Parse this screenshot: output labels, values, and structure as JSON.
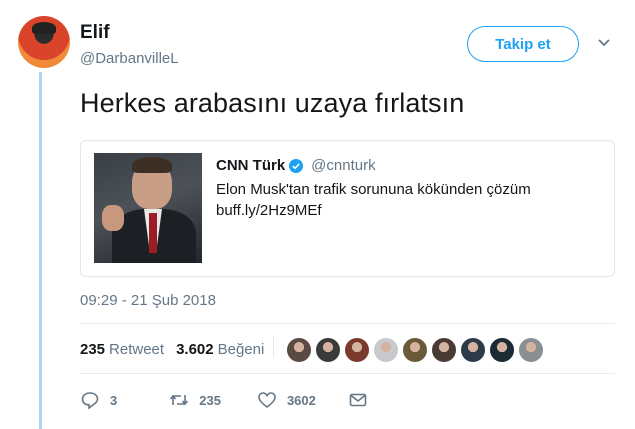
{
  "author": {
    "name": "Elif",
    "handle": "@DarbanvilleL"
  },
  "follow_button": {
    "label": "Takip et"
  },
  "tweet": {
    "text": "Herkes arabasını uzaya fırlatsın",
    "timestamp": "09:29 - 21 Şub 2018"
  },
  "quoted": {
    "author": "CNN Türk",
    "handle": "@cnnturk",
    "text": "Elon Musk'tan trafik sorununa kökünden çözüm",
    "link": "buff.ly/2Hz9MEf"
  },
  "stats": {
    "retweet_count": "235",
    "retweet_label": "Retweet",
    "like_count": "3.602",
    "like_label": "Beğeni"
  },
  "liker_colors": [
    "#5a4a42",
    "#3b3b3b",
    "#7a3b2e",
    "#c7c9cc",
    "#6b5a3a",
    "#4a3a34",
    "#2d3a4a",
    "#1b2a33",
    "#8a8f94"
  ],
  "actions": {
    "reply_count": "3",
    "retweet_count": "235",
    "like_count": "3602"
  },
  "colors": {
    "accent": "#1da1f2",
    "thread_line": "#a9d6f5",
    "muted": "#657786"
  },
  "icons": [
    "chevron-down-icon",
    "verified-icon",
    "reply-icon",
    "retweet-icon",
    "heart-icon",
    "mail-icon"
  ]
}
